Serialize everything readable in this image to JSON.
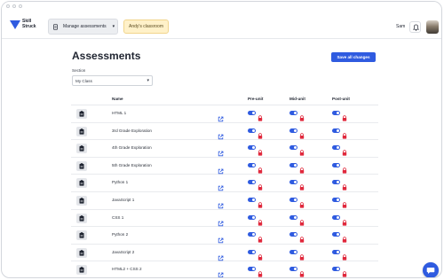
{
  "app": {
    "brand_line1": "Skill",
    "brand_line2": "Struck"
  },
  "header": {
    "manage_label": "Manage assessments",
    "classroom_label": "Andy's classroom",
    "user_name": "Sam"
  },
  "page": {
    "title": "Assessments",
    "save_label": "Save all changes",
    "section_label": "Section",
    "section_value": "My Class"
  },
  "table": {
    "columns": {
      "name": "Name",
      "pre": "Pre-unit",
      "mid": "Mid-unit",
      "post": "Post-unit"
    },
    "rows": [
      {
        "name": "HTML 1"
      },
      {
        "name": "3rd Grade Exploration"
      },
      {
        "name": "4th Grade Exploration"
      },
      {
        "name": "5th Grade Exploration"
      },
      {
        "name": "Python 1"
      },
      {
        "name": "JavaScript 1"
      },
      {
        "name": "CSS 1"
      },
      {
        "name": "Python 2"
      },
      {
        "name": "JavaScript 2"
      },
      {
        "name": "HTML2 + CSS 2"
      }
    ]
  },
  "colors": {
    "accent": "#2f5be0",
    "lock": "#e0283c",
    "classroom_bg": "#fff1c9"
  }
}
